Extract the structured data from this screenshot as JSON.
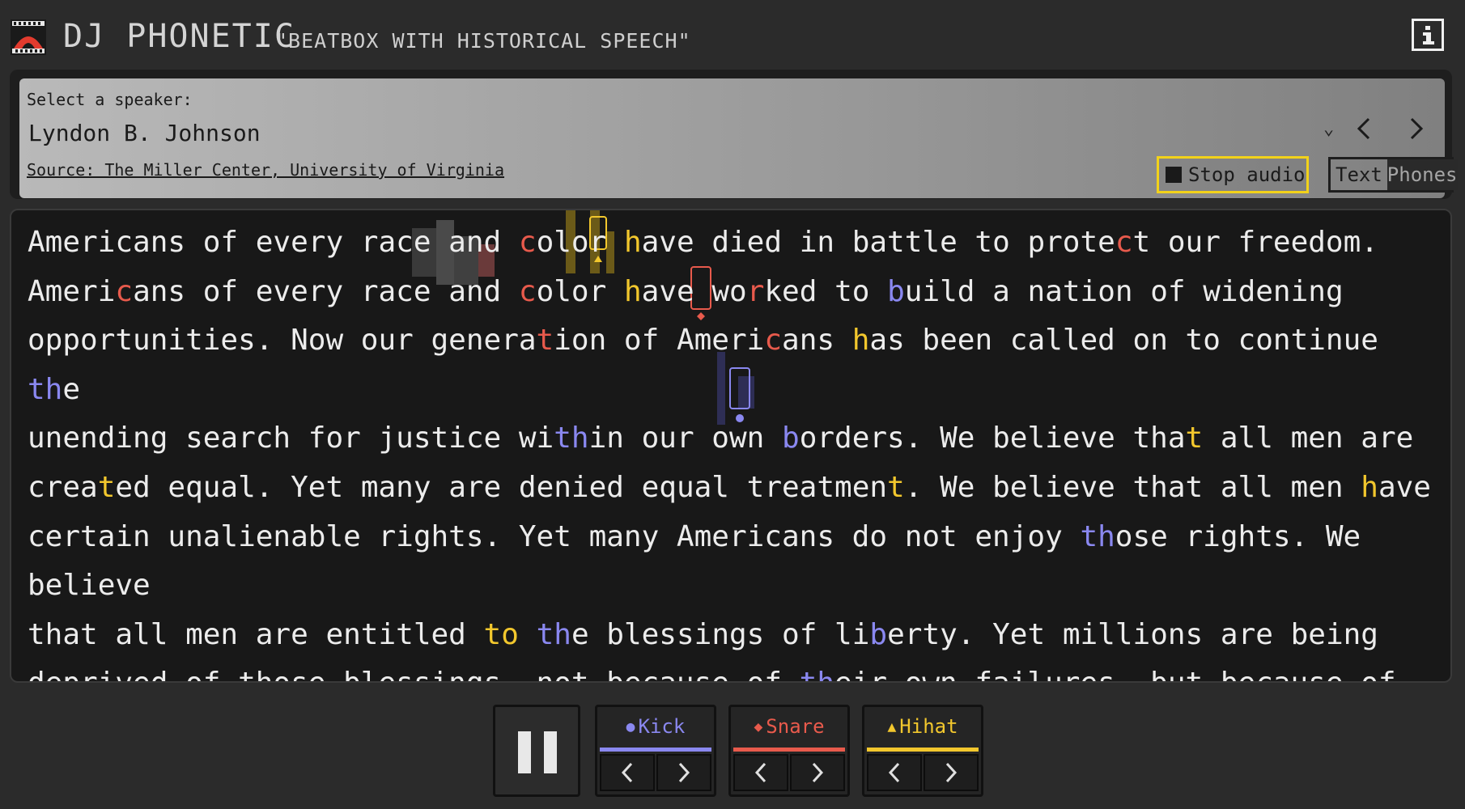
{
  "header": {
    "title": "DJ PHONETIC",
    "subtitle": "\"BEATBOX WITH HISTORICAL SPEECH\"",
    "logo_icon": "speaker-mouth-icon",
    "info_icon": "info-icon"
  },
  "speaker_panel": {
    "select_label": "Select a speaker:",
    "selected_speaker": "Lyndon B. Johnson",
    "source_text": "Source: The Miller Center, University of Virginia",
    "stop_audio_label": "Stop audio",
    "mode_text_label": "Text",
    "mode_phones_label": "Phones"
  },
  "transcript": {
    "text": "Americans of every race and color have died in battle to protect our freedom. Americans of every race and color have worked to build a nation of widening opportunities. Now our generation of Americans has been called on to continue the unending search for justice within our own borders. We believe that all men are created equal. Yet many are denied equal treatment. We believe that all men have certain unalienable rights. Yet many Americans do not enjoy those rights. We believe that all men are entitled to the blessings of liberty. Yet millions are being deprived of those blessings- not because of their own failures, but because of the color of their skin"
  },
  "controls": {
    "pause_icon": "pause-icon",
    "tracks": [
      {
        "name": "Kick",
        "symbol": "●",
        "color": "#8a88f0"
      },
      {
        "name": "Snare",
        "symbol": "◆",
        "color": "#e85a4c"
      },
      {
        "name": "Hihat",
        "symbol": "▲",
        "color": "#f2c72d"
      }
    ]
  },
  "colors": {
    "background": "#2b2b2b",
    "kick": "#8a88f0",
    "snare": "#e85a4c",
    "hihat": "#f2c72d"
  }
}
